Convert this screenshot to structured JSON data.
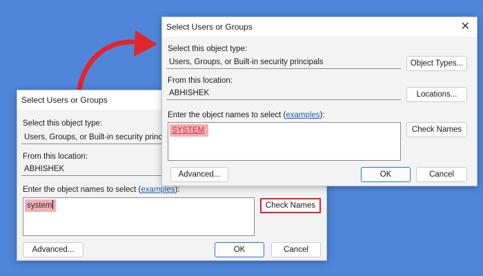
{
  "colors": {
    "background": "#4f86d9",
    "dialog_bg": "#f3f3f3",
    "selection_highlight": "#f4aeb5",
    "annotation_red": "#e2252a",
    "link": "#1d5bb5",
    "primary_border": "#2a6fd0"
  },
  "back_dialog": {
    "title": "Select Users or Groups",
    "object_type_label": "Select this object type:",
    "object_type_value": "Users, Groups, or Built-in security principals",
    "location_label": "From this location:",
    "location_value": "ABHISHEK",
    "names_label": "Enter the object names to select (",
    "names_link": "examples",
    "names_label_end": "):",
    "names_value": "system",
    "check_names_label": "Check Names",
    "advanced_label": "Advanced...",
    "ok_label": "OK",
    "cancel_label": "Cancel"
  },
  "front_dialog": {
    "title": "Select Users or Groups",
    "close_glyph": "✕",
    "object_type_label": "Select this object type:",
    "object_type_value": "Users, Groups, or Built-in security principals",
    "object_types_button": "Object Types...",
    "location_label": "From this location:",
    "location_value": "ABHISHEK",
    "locations_button": "Locations...",
    "names_label": "Enter the object names to select (",
    "names_link": "examples",
    "names_label_end": "):",
    "names_value": "SYSTEM",
    "check_names_label": "Check Names",
    "advanced_label": "Advanced...",
    "ok_label": "OK",
    "cancel_label": "Cancel"
  },
  "icons": {
    "arrow": "curved-arrow-icon",
    "close": "close-icon"
  }
}
